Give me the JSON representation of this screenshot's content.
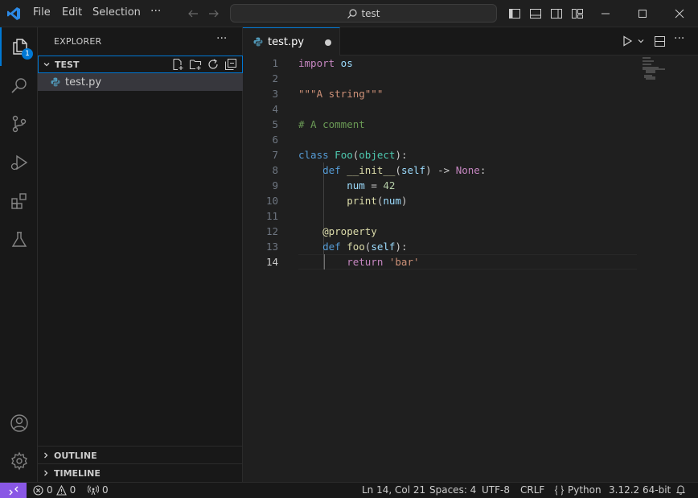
{
  "menu": {
    "file": "File",
    "edit": "Edit",
    "selection": "Selection",
    "more": "···"
  },
  "search": {
    "text": "test"
  },
  "explorer": {
    "title": "EXPLORER",
    "more": "···",
    "folder": "TEST",
    "file": "test.py",
    "outline": "OUTLINE",
    "timeline": "TIMELINE"
  },
  "activity": {
    "explorer_badge": "1"
  },
  "tab": {
    "label": "test.py"
  },
  "editor": {
    "line_numbers": [
      "1",
      "2",
      "3",
      "4",
      "5",
      "6",
      "7",
      "8",
      "9",
      "10",
      "11",
      "12",
      "13",
      "14"
    ],
    "current_line": "14",
    "code": {
      "l1_kw": "import",
      "l1_mod": " os",
      "l3": "\"\"\"A string\"\"\"",
      "l5": "# A comment",
      "l7_kw": "class",
      "l7_cls": " Foo",
      "l7_p1": "(",
      "l7_base": "object",
      "l7_p2": "):",
      "l8_kw": "    def",
      "l8_fn": " __init__",
      "l8_p1": "(",
      "l8_self": "self",
      "l8_p2": ") -> ",
      "l8_none": "None",
      "l8_p3": ":",
      "l9_var": "        num",
      "l9_eq": " = ",
      "l9_num": "42",
      "l10_fn": "        print",
      "l10_p1": "(",
      "l10_arg": "num",
      "l10_p2": ")",
      "l12": "    @property",
      "l13_kw": "    def",
      "l13_fn": " foo",
      "l13_p1": "(",
      "l13_self": "self",
      "l13_p2": "):",
      "l14_kw": "        return",
      "l14_str": " 'bar'"
    }
  },
  "status": {
    "errors": "0",
    "warnings": "0",
    "ports": "0",
    "position": "Ln 14, Col 21",
    "spaces": "Spaces: 4",
    "encoding": "UTF-8",
    "eol": "CRLF",
    "language": "Python",
    "interpreter": "3.12.2 64-bit"
  },
  "colors": {
    "accent": "#0078d4",
    "remote": "#8957e5",
    "badge": "#0078d4"
  }
}
